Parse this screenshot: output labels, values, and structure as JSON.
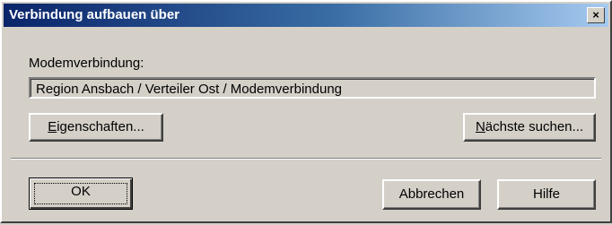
{
  "window": {
    "title": "Verbindung aufbauen über",
    "close_glyph": "×"
  },
  "main": {
    "connection_label": "Modemverbindung:",
    "connection_value": "Region Ansbach / Verteiler Ost / Modemverbindung"
  },
  "buttons": {
    "properties_access": "E",
    "properties_rest": "igenschaften...",
    "next_access": "N",
    "next_rest": "ächste suchen...",
    "ok": "OK",
    "cancel": "Abbrechen",
    "help": "Hilfe"
  }
}
